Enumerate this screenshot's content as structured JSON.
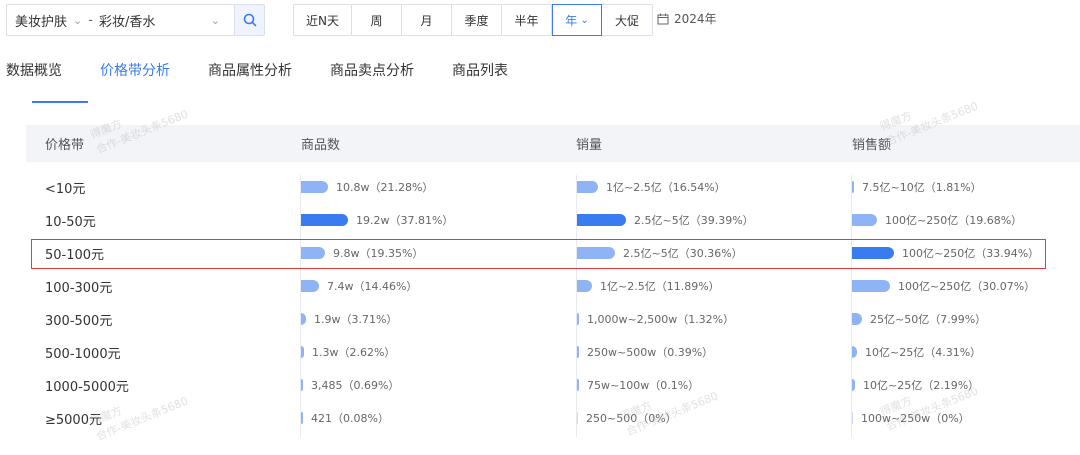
{
  "filters": {
    "category_main": "美妆护肤",
    "separator": "-",
    "category_sub": "彩妆/香水",
    "time_options": [
      "近N天",
      "周",
      "月",
      "季度",
      "半年",
      "年",
      "大促"
    ],
    "active_time": "年",
    "date": "2024年"
  },
  "tabs": [
    {
      "label": "数据概览",
      "active": false
    },
    {
      "label": "价格带分析",
      "active": true
    },
    {
      "label": "商品属性分析",
      "active": false
    },
    {
      "label": "商品卖点分析",
      "active": false
    },
    {
      "label": "商品列表",
      "active": false
    }
  ],
  "table": {
    "headers": [
      "价格带",
      "商品数",
      "销量",
      "销售额"
    ],
    "rows": [
      {
        "price": "<10元",
        "count": {
          "text": "10.8w（21.28%）",
          "pct": 21.28,
          "dark": false
        },
        "sales": {
          "text": "1亿~2.5亿（16.54%）",
          "pct": 16.54,
          "dark": false
        },
        "revenue": {
          "text": "7.5亿~10亿（1.81%）",
          "pct": 1.81,
          "dark": false
        }
      },
      {
        "price": "10-50元",
        "count": {
          "text": "19.2w（37.81%）",
          "pct": 37.81,
          "dark": true
        },
        "sales": {
          "text": "2.5亿~5亿（39.39%）",
          "pct": 39.39,
          "dark": true
        },
        "revenue": {
          "text": "100亿~250亿（19.68%）",
          "pct": 19.68,
          "dark": false
        }
      },
      {
        "price": "50-100元",
        "count": {
          "text": "9.8w（19.35%）",
          "pct": 19.35,
          "dark": false
        },
        "sales": {
          "text": "2.5亿~5亿（30.36%）",
          "pct": 30.36,
          "dark": false
        },
        "revenue": {
          "text": "100亿~250亿（33.94%）",
          "pct": 33.94,
          "dark": true
        }
      },
      {
        "price": "100-300元",
        "count": {
          "text": "7.4w（14.46%）",
          "pct": 14.46,
          "dark": false
        },
        "sales": {
          "text": "1亿~2.5亿（11.89%）",
          "pct": 11.89,
          "dark": false
        },
        "revenue": {
          "text": "100亿~250亿（30.07%）",
          "pct": 30.07,
          "dark": false
        }
      },
      {
        "price": "300-500元",
        "count": {
          "text": "1.9w（3.71%）",
          "pct": 3.71,
          "dark": false
        },
        "sales": {
          "text": "1,000w~2,500w（1.32%）",
          "pct": 1.32,
          "dark": false
        },
        "revenue": {
          "text": "25亿~50亿（7.99%）",
          "pct": 7.99,
          "dark": false
        }
      },
      {
        "price": "500-1000元",
        "count": {
          "text": "1.3w（2.62%）",
          "pct": 2.62,
          "dark": false
        },
        "sales": {
          "text": "250w~500w（0.39%）",
          "pct": 0.39,
          "dark": false
        },
        "revenue": {
          "text": "10亿~25亿（4.31%）",
          "pct": 4.31,
          "dark": false
        }
      },
      {
        "price": "1000-5000元",
        "count": {
          "text": "3,485（0.69%）",
          "pct": 0.69,
          "dark": false
        },
        "sales": {
          "text": "75w~100w（0.1%）",
          "pct": 0.1,
          "dark": false
        },
        "revenue": {
          "text": "10亿~25亿（2.19%）",
          "pct": 2.19,
          "dark": false
        }
      },
      {
        "price": "≥5000元",
        "count": {
          "text": "421（0.08%）",
          "pct": 0.08,
          "dark": false
        },
        "sales": {
          "text": "250~500（0%）",
          "pct": 0,
          "dark": false
        },
        "revenue": {
          "text": "100w~250w（0%）",
          "pct": 0,
          "dark": false
        }
      }
    ],
    "highlighted_row": "50-100元"
  },
  "watermark": {
    "line1": "得魔方",
    "line2": "合作-美妆头条5680"
  },
  "colors": {
    "accent": "#3a7bf0",
    "bar_light": "#8fb4f5",
    "highlight": "#e23b3b"
  }
}
